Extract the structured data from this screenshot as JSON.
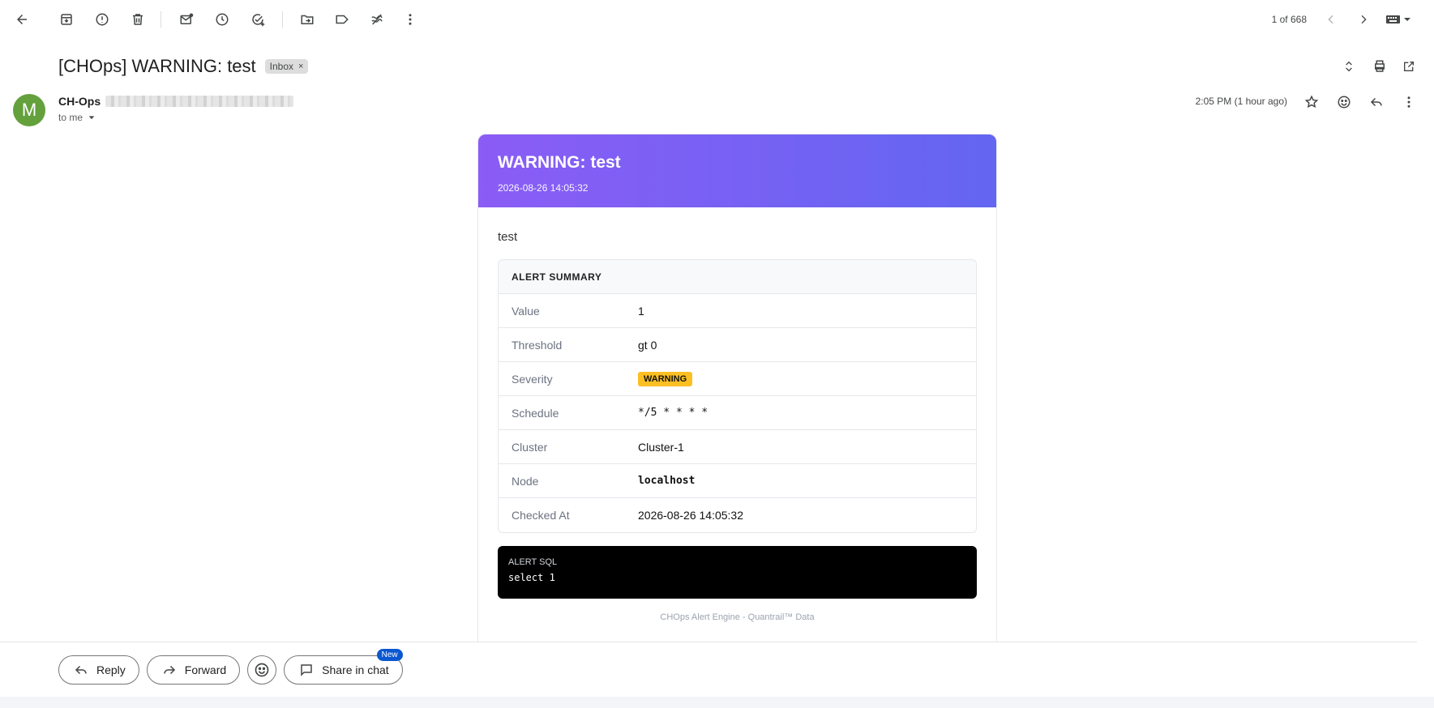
{
  "toolbar": {
    "icons": [
      "back-arrow-icon",
      "archive-icon",
      "report-spam-icon",
      "delete-icon",
      "mark-unread-icon",
      "snooze-icon",
      "add-task-icon",
      "move-to-icon",
      "label-icon",
      "filter-icon",
      "more-vert-icon"
    ],
    "pager": "1 of 668",
    "right_icons": [
      "chevron-left-icon",
      "chevron-right-icon",
      "keyboard-icon"
    ]
  },
  "email": {
    "subject": "[CHOps] WARNING: test",
    "label": "Inbox",
    "label_remove": "×",
    "avatar_letter": "M",
    "avatar_color": "#64a03c",
    "sender_name": "CH-Ops",
    "recipient": "to me",
    "time": "2:05 PM (1 hour ago)"
  },
  "alert": {
    "title": "WARNING: test",
    "timestamp": "2026-08-26 14:05:32",
    "description": "test",
    "summary_title": "ALERT SUMMARY",
    "rows": [
      {
        "key": "Value",
        "value": "1"
      },
      {
        "key": "Threshold",
        "value": "gt 0"
      },
      {
        "key": "Severity",
        "value": "WARNING"
      },
      {
        "key": "Schedule",
        "value": "*/5 * * * *"
      },
      {
        "key": "Cluster",
        "value": "Cluster-1"
      },
      {
        "key": "Node",
        "value": "localhost"
      },
      {
        "key": "Checked At",
        "value": "2026-08-26 14:05:32"
      }
    ],
    "sql_label": "ALERT SQL",
    "sql_code": "select 1",
    "footer": "CHOps Alert Engine - Quantrail™ Data",
    "header_gradient": [
      "#8b5cf6",
      "#6366f1"
    ],
    "badge_color": "#fbbf24"
  },
  "actions": {
    "reply": "Reply",
    "forward": "Forward",
    "share": "Share in chat",
    "new_badge": "New"
  }
}
